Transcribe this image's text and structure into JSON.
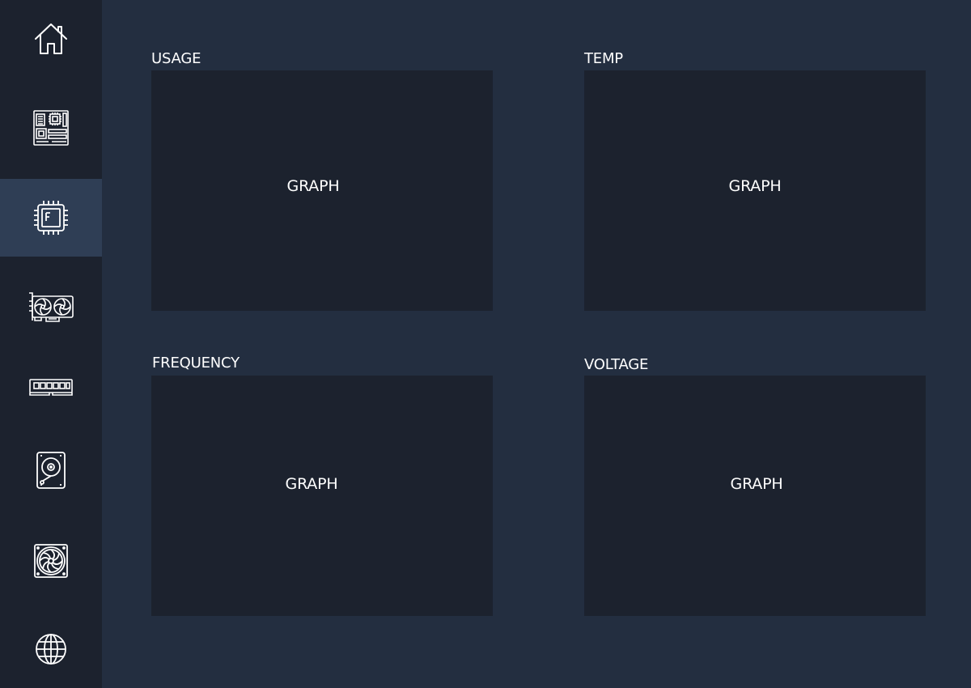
{
  "sidebar": {
    "items": [
      {
        "name": "home",
        "icon": "home-icon",
        "active": false
      },
      {
        "name": "motherboard",
        "icon": "motherboard-icon",
        "active": false
      },
      {
        "name": "cpu",
        "icon": "cpu-icon",
        "active": true
      },
      {
        "name": "gpu",
        "icon": "gpu-icon",
        "active": false
      },
      {
        "name": "ram",
        "icon": "ram-icon",
        "active": false
      },
      {
        "name": "storage",
        "icon": "hard-drive-icon",
        "active": false
      },
      {
        "name": "cooling",
        "icon": "fan-icon",
        "active": false
      },
      {
        "name": "network",
        "icon": "globe-icon",
        "active": false
      }
    ]
  },
  "panels": {
    "usage": {
      "title": "USAGE",
      "placeholder": "GRAPH"
    },
    "temp": {
      "title": "TEMP",
      "placeholder": "GRAPH"
    },
    "frequency": {
      "title": "FREQUENCY",
      "placeholder": "GRAPH"
    },
    "voltage": {
      "title": "VOLTAGE",
      "placeholder": "GRAPH"
    }
  },
  "colors": {
    "background": "#232e40",
    "sidebar": "#1c222e",
    "sidebar_active": "#2f3e55",
    "panel": "#1c222e",
    "text": "#ffffff"
  }
}
